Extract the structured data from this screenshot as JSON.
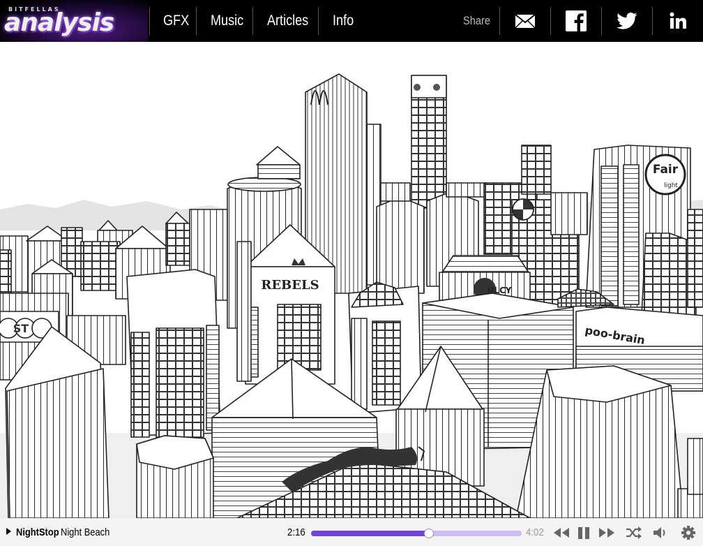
{
  "header": {
    "logo_small": "BITFELLAS",
    "logo_big": "analysis",
    "nav": [
      {
        "label": "GFX"
      },
      {
        "label": "Music"
      },
      {
        "label": "Articles"
      },
      {
        "label": "Info"
      }
    ],
    "share_label": "Share",
    "social_icons": [
      "mail-icon",
      "facebook-icon",
      "twitter-icon",
      "linkedin-icon"
    ]
  },
  "scene": {
    "signs": {
      "rebels": "REBELS",
      "fairlight_top": "Fair",
      "fairlight_bottom": "light",
      "poobrain": "poo-brain",
      "vulcy": "ULCY",
      "toast": "ST"
    }
  },
  "player": {
    "artist": "NightStop",
    "track": "Night Beach",
    "current_time": "2:16",
    "total_time": "4:02",
    "progress": 0.56,
    "colors": {
      "fill": "#6f45e0",
      "track": "#cdbdf5"
    },
    "controls": [
      "rewind-icon",
      "pause-icon",
      "fast-forward-icon",
      "shuffle-icon",
      "volume-icon",
      "settings-icon"
    ]
  }
}
